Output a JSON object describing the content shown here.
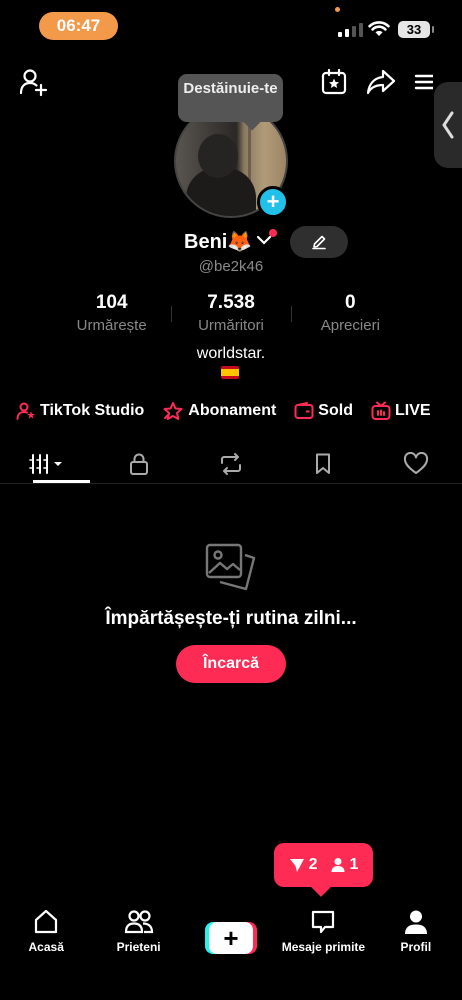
{
  "status_bar": {
    "time": "06:47",
    "battery": "33"
  },
  "avatar_tooltip": "Destăinuie-te",
  "profile": {
    "name": "Beni🦊",
    "handle": "@be2k46",
    "bio": "worldstar.",
    "flag": "spain-flag"
  },
  "stats": [
    {
      "value": "104",
      "label": "Urmărește"
    },
    {
      "value": "7.538",
      "label": "Urmăritori"
    },
    {
      "value": "0",
      "label": "Aprecieri"
    }
  ],
  "features": [
    {
      "label": "TikTok Studio",
      "icon": "studio-icon"
    },
    {
      "label": "Abonament",
      "icon": "subscription-icon"
    },
    {
      "label": "Sold",
      "icon": "wallet-icon"
    },
    {
      "label": "LIVE",
      "icon": "live-tv-icon"
    }
  ],
  "tabs": [
    {
      "icon": "grid-icon",
      "active": true
    },
    {
      "icon": "lock-icon"
    },
    {
      "icon": "repost-icon"
    },
    {
      "icon": "bookmark-icon"
    },
    {
      "icon": "heart-icon"
    }
  ],
  "empty_state": {
    "title": "Împărtășește-ți rutina zilni...",
    "button": "Încarcă"
  },
  "notification": {
    "messages": "2",
    "followers": "1"
  },
  "nav": [
    {
      "label": "Acasă",
      "icon": "home-icon"
    },
    {
      "label": "Prieteni",
      "icon": "friends-icon"
    },
    {
      "label": "",
      "icon": "create-icon"
    },
    {
      "label": "Mesaje primite",
      "icon": "inbox-icon"
    },
    {
      "label": "Profil",
      "icon": "profile-icon"
    }
  ],
  "colors": {
    "accent": "#fe2c55",
    "cyan": "#25f4ee",
    "badge_blue": "#20c0e8",
    "time_pill": "#f2994a"
  }
}
